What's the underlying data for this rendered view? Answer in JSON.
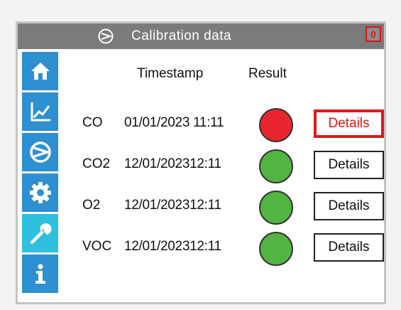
{
  "titlebar": {
    "title": "Calibration data",
    "icon": "compressor-icon",
    "alert_badge": "0"
  },
  "sidebar": {
    "items": [
      {
        "name": "home",
        "icon": "home-icon"
      },
      {
        "name": "chart",
        "icon": "chart-icon"
      },
      {
        "name": "calibration",
        "icon": "compressor-icon"
      },
      {
        "name": "settings",
        "icon": "gear-icon"
      },
      {
        "name": "service",
        "icon": "wrench-icon",
        "active": true
      },
      {
        "name": "info",
        "icon": "info-icon"
      }
    ]
  },
  "table": {
    "header_timestamp": "Timestamp",
    "header_result": "Result",
    "rows": [
      {
        "gas": "CO",
        "timestamp": "01/01/2023 11:11",
        "result": "fail",
        "result_color": "#e8252f",
        "details": "Details"
      },
      {
        "gas": "CO2",
        "timestamp": "12/01/202312:11",
        "result": "pass",
        "result_color": "#52b541",
        "details": "Details"
      },
      {
        "gas": "O2",
        "timestamp": "12/01/202312:11",
        "result": "pass",
        "result_color": "#52b541",
        "details": "Details"
      },
      {
        "gas": "VOC",
        "timestamp": "12/01/202312:11",
        "result": "pass",
        "result_color": "#52b541",
        "details": "Details"
      }
    ]
  },
  "colors": {
    "nav": "#2e8fd1",
    "nav_active": "#2fc0dd",
    "titlebar": "#7b7b7b",
    "alert": "#e01818"
  }
}
